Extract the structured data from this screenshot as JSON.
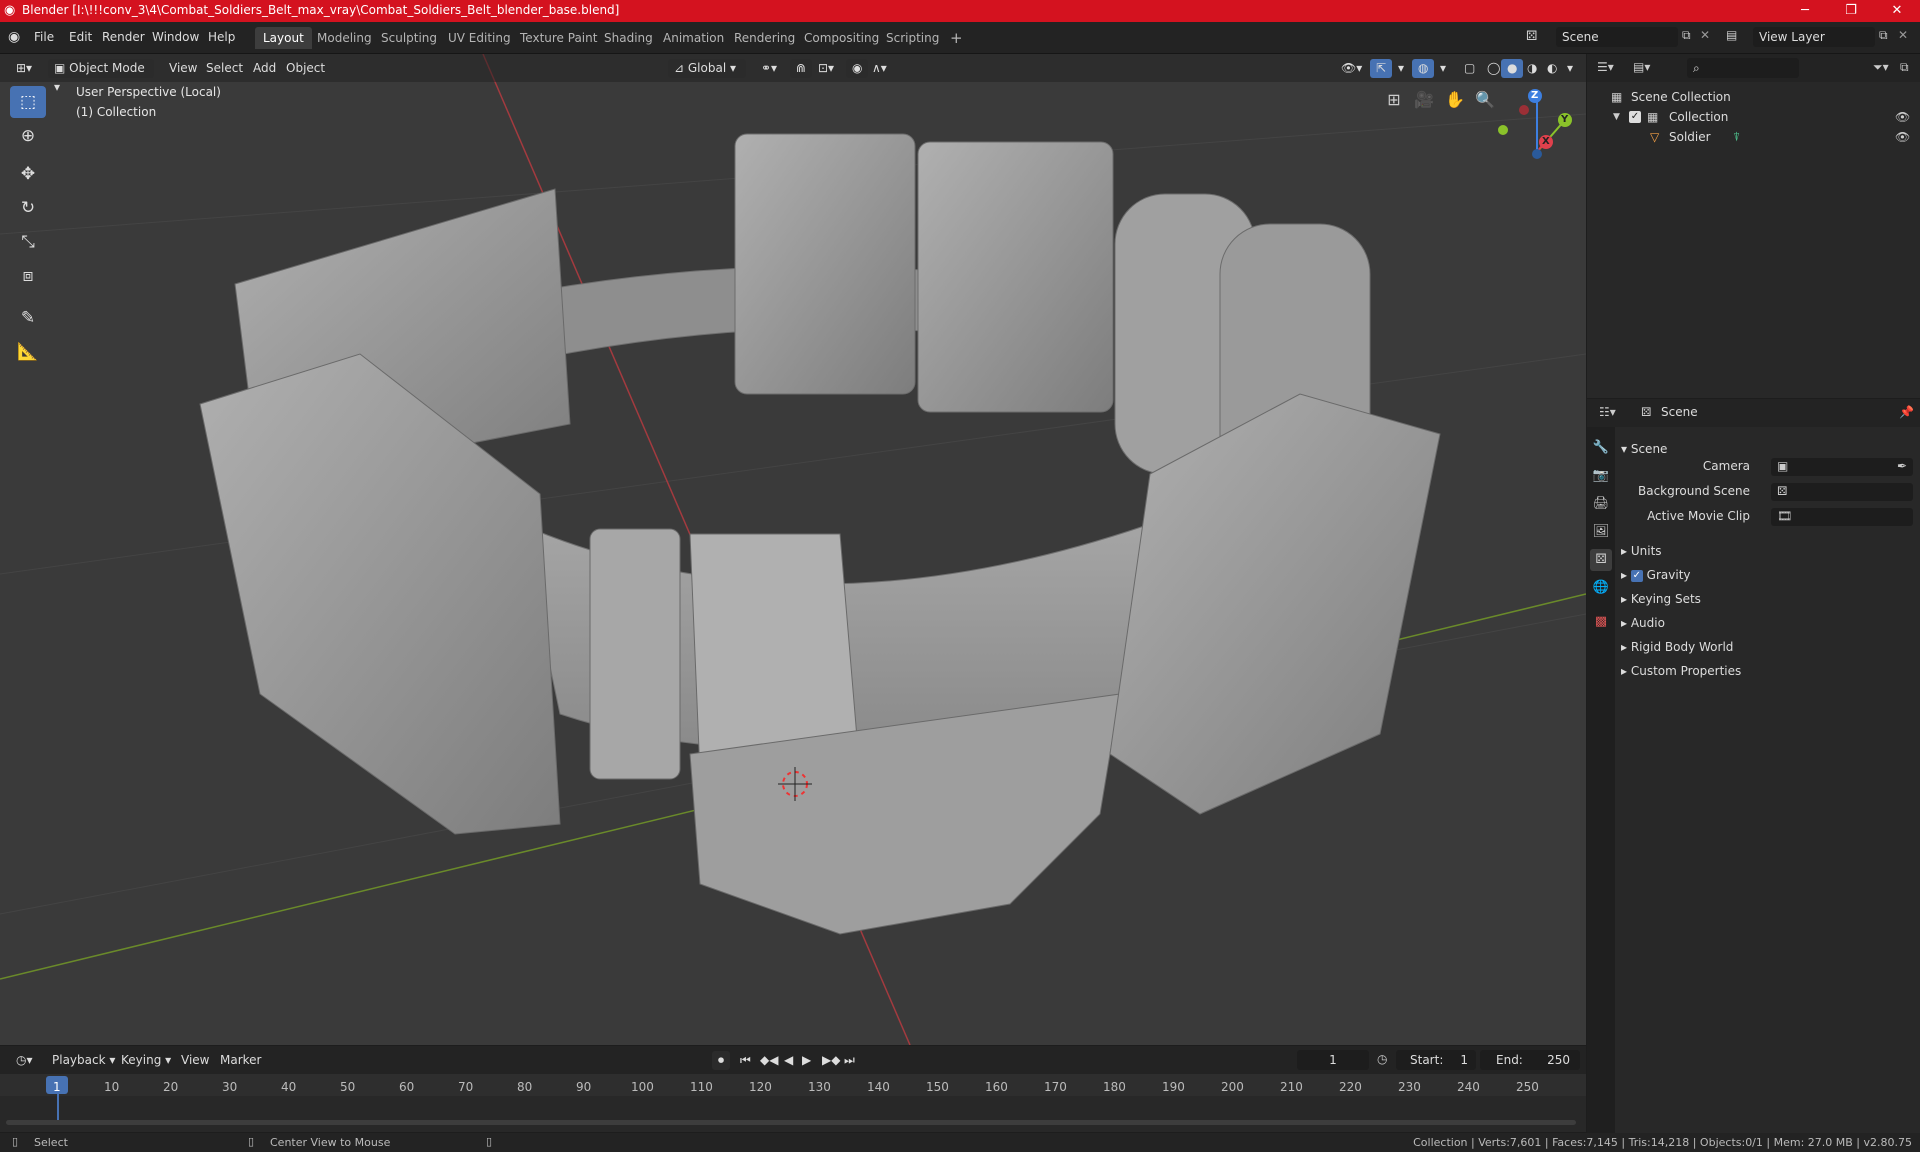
{
  "window": {
    "title": "Blender [I:\\!!!conv_3\\4\\Combat_Soldiers_Belt_max_vray\\Combat_Soldiers_Belt_blender_base.blend]",
    "minimize": "─",
    "maximize": "❐",
    "close": "✕"
  },
  "menu": [
    "File",
    "Edit",
    "Render",
    "Window",
    "Help"
  ],
  "workspaces": [
    "Layout",
    "Modeling",
    "Sculpting",
    "UV Editing",
    "Texture Paint",
    "Shading",
    "Animation",
    "Rendering",
    "Compositing",
    "Scripting"
  ],
  "workspace_add": "+",
  "scene_field": "Scene",
  "viewlayer_field": "View Layer",
  "viewport_header": {
    "mode": "Object Mode",
    "items": [
      "View",
      "Select",
      "Add",
      "Object"
    ],
    "transform": "Global"
  },
  "viewport": {
    "line1": "User Perspective (Local)",
    "line2": "(1) Collection",
    "axis_x": "X",
    "axis_y": "Y",
    "axis_z": "Z"
  },
  "outliner": {
    "root": "Scene Collection",
    "collection": "Collection",
    "object": "Soldier"
  },
  "properties": {
    "context": "Scene",
    "section": "Scene",
    "camera_label": "Camera",
    "background_label": "Background Scene",
    "movieclip_label": "Active Movie Clip",
    "sections": [
      "Units",
      "Gravity",
      "Keying Sets",
      "Audio",
      "Rigid Body World",
      "Custom Properties"
    ]
  },
  "timeline": {
    "menus": [
      "Playback",
      "Keying",
      "View",
      "Marker"
    ],
    "current_frame": "1",
    "start_label": "Start:",
    "start": "1",
    "end_label": "End:",
    "end": "250",
    "ticks": [
      "1",
      "10",
      "20",
      "30",
      "40",
      "50",
      "60",
      "70",
      "80",
      "90",
      "100",
      "110",
      "120",
      "130",
      "140",
      "150",
      "160",
      "170",
      "180",
      "190",
      "200",
      "210",
      "220",
      "230",
      "240",
      "250"
    ]
  },
  "status": {
    "select": "Select",
    "center": "Center View to Mouse",
    "stats": "Collection | Verts:7,601 | Faces:7,145 | Tris:14,218 | Objects:0/1 | Mem: 27.0 MB | v2.80.75"
  },
  "colors": {
    "accent": "#4772b3",
    "titlebar": "#d4121f",
    "x_axis": "#e0404c",
    "y_axis": "#8ac22a",
    "z_axis": "#3d7fe0"
  }
}
